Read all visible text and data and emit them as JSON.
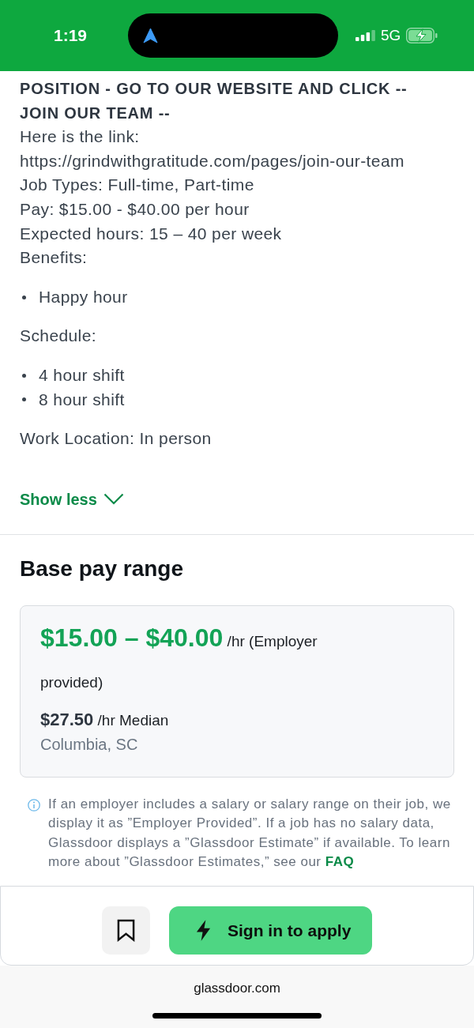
{
  "status_bar": {
    "time": "1:19",
    "network": "5G"
  },
  "description": {
    "blocks": [
      {
        "kind": "lines",
        "lines": [
          {
            "kind": "heading",
            "text": "POSITION - GO TO OUR WEBSITE AND CLICK -- JOIN OUR TEAM --"
          },
          {
            "kind": "text",
            "text": "Here is the link:"
          },
          {
            "kind": "text",
            "text": "https://grindwithgratitude.com/pages/join-our-team"
          },
          {
            "kind": "text",
            "text": "Job Types: Full-time, Part-time"
          },
          {
            "kind": "text",
            "text": "Pay: $15.00 - $40.00 per hour"
          },
          {
            "kind": "text",
            "text": "Expected hours: 15 – 40 per week"
          },
          {
            "kind": "text",
            "text": "Benefits:"
          }
        ]
      },
      {
        "kind": "bullets",
        "items": [
          "Happy hour"
        ]
      },
      {
        "kind": "lines",
        "lines": [
          {
            "kind": "text",
            "text": "Schedule:"
          }
        ]
      },
      {
        "kind": "bullets",
        "items": [
          "4 hour shift",
          "8 hour shift"
        ]
      },
      {
        "kind": "lines",
        "lines": [
          {
            "kind": "text",
            "text": "Work Location: In person"
          }
        ]
      }
    ],
    "toggle": "Show less"
  },
  "base_pay": {
    "title": "Base pay range",
    "range": "$15.00 – $40.00",
    "range_note": "/hr (Employer provided)",
    "median": "$27.50",
    "median_note": "/hr Median",
    "location": "Columbia, SC"
  },
  "salary_info": {
    "text": "If an employer includes a salary or salary range on their job, we display it as ”Employer Provided”. If a job has no salary data, Glassdoor displays a ”Glassdoor Estimate” if available. To learn more about ”Glassdoor Estimates,” see our",
    "link": "FAQ"
  },
  "actions": {
    "apply": "Sign in to apply"
  },
  "browser": {
    "url": "glassdoor.com"
  }
}
